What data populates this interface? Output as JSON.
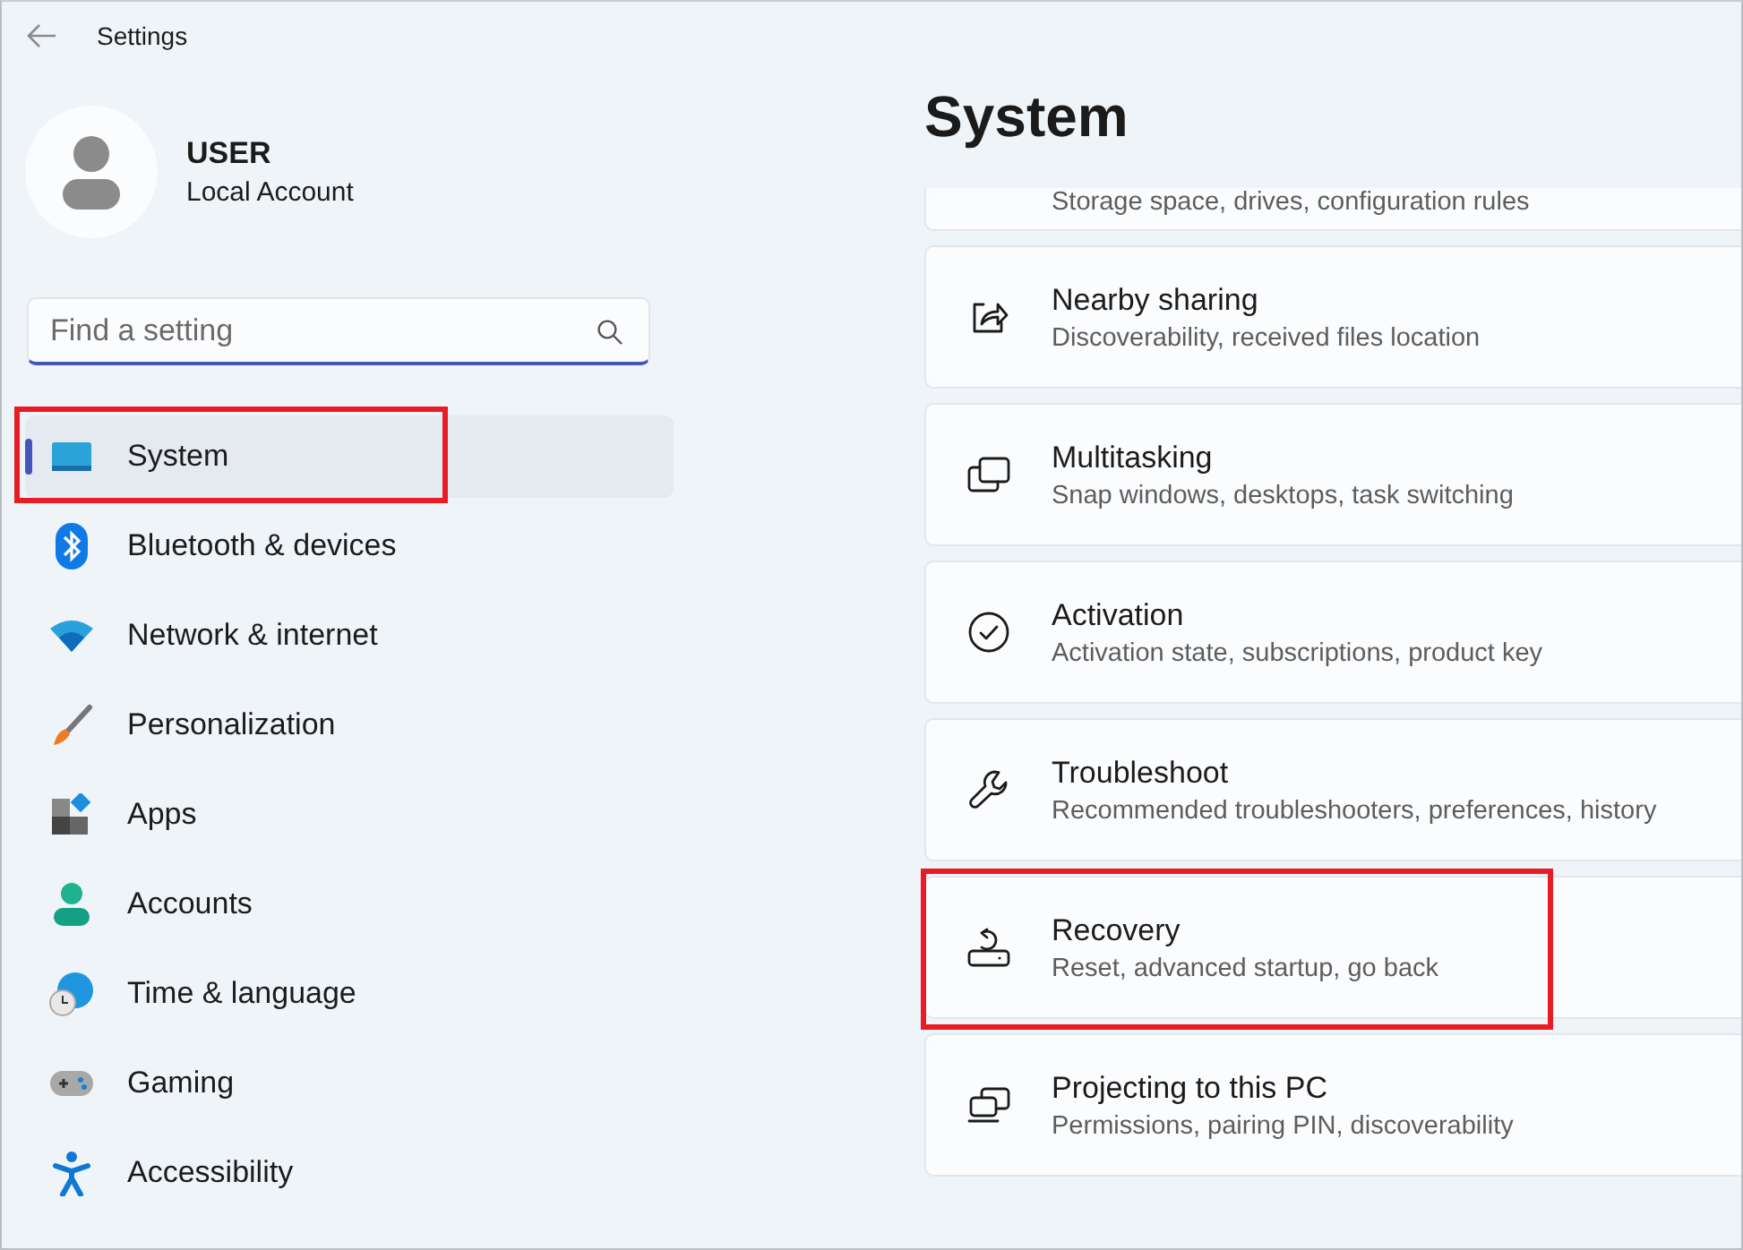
{
  "window": {
    "title": "Settings"
  },
  "account": {
    "name": "USER",
    "type": "Local Account"
  },
  "search": {
    "placeholder": "Find a setting"
  },
  "sidebar": {
    "items": [
      {
        "label": "System",
        "selected": true,
        "highlighted": true
      },
      {
        "label": "Bluetooth & devices",
        "selected": false,
        "highlighted": false
      },
      {
        "label": "Network & internet",
        "selected": false,
        "highlighted": false
      },
      {
        "label": "Personalization",
        "selected": false,
        "highlighted": false
      },
      {
        "label": "Apps",
        "selected": false,
        "highlighted": false
      },
      {
        "label": "Accounts",
        "selected": false,
        "highlighted": false
      },
      {
        "label": "Time & language",
        "selected": false,
        "highlighted": false
      },
      {
        "label": "Gaming",
        "selected": false,
        "highlighted": false
      },
      {
        "label": "Accessibility",
        "selected": false,
        "highlighted": false
      }
    ]
  },
  "page": {
    "title": "System",
    "items": [
      {
        "kind": "partial",
        "subtitle": "Storage space, drives, configuration rules",
        "highlighted": false
      },
      {
        "kind": "card",
        "title": "Nearby sharing",
        "subtitle": "Discoverability, received files location",
        "highlighted": false
      },
      {
        "kind": "card",
        "title": "Multitasking",
        "subtitle": "Snap windows, desktops, task switching",
        "highlighted": false
      },
      {
        "kind": "card",
        "title": "Activation",
        "subtitle": "Activation state, subscriptions, product key",
        "highlighted": false
      },
      {
        "kind": "card",
        "title": "Troubleshoot",
        "subtitle": "Recommended troubleshooters, preferences, history",
        "highlighted": false
      },
      {
        "kind": "card",
        "title": "Recovery",
        "subtitle": "Reset, advanced startup, go back",
        "highlighted": true
      },
      {
        "kind": "card",
        "title": "Projecting to this PC",
        "subtitle": "Permissions, pairing PIN, discoverability",
        "highlighted": false
      }
    ]
  }
}
